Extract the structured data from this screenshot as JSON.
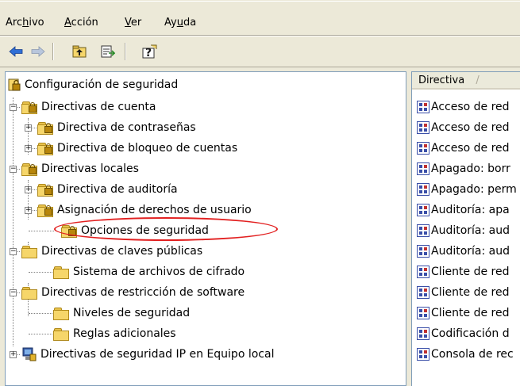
{
  "menubar": {
    "items": [
      {
        "label": "Archivo",
        "pre": "Arc",
        "key": "h",
        "post": "ivo"
      },
      {
        "label": "Acción",
        "pre": "",
        "key": "A",
        "post": "cción"
      },
      {
        "label": "Ver",
        "pre": "",
        "key": "V",
        "post": "er"
      },
      {
        "label": "Ayuda",
        "pre": "Ay",
        "key": "u",
        "post": "da"
      }
    ]
  },
  "toolbar": {
    "buttons": [
      "back-arrow-icon",
      "forward-arrow-icon",
      "up-folder-icon",
      "export-list-icon",
      "help-icon"
    ]
  },
  "tree": {
    "root": "Configuración de seguridad",
    "items": [
      {
        "label": "Directivas de cuenta",
        "level": 1,
        "expander": "-"
      },
      {
        "label": "Directiva de contraseñas",
        "level": 2,
        "expander": "+"
      },
      {
        "label": "Directiva de bloqueo de cuentas",
        "level": 2,
        "expander": "+"
      },
      {
        "label": "Directivas locales",
        "level": 1,
        "expander": "-"
      },
      {
        "label": "Directiva de auditoría",
        "level": 2,
        "expander": "+"
      },
      {
        "label": "Asignación de derechos de usuario",
        "level": 2,
        "expander": "+"
      },
      {
        "label": "Opciones de seguridad",
        "level": 2,
        "expander": "",
        "selected": true
      },
      {
        "label": "Directivas de claves públicas",
        "level": 1,
        "expander": "-"
      },
      {
        "label": "Sistema de archivos de cifrado",
        "level": 2,
        "expander": ""
      },
      {
        "label": "Directivas de restricción de software",
        "level": 1,
        "expander": "-"
      },
      {
        "label": "Niveles de seguridad",
        "level": 2,
        "expander": ""
      },
      {
        "label": "Reglas adicionales",
        "level": 2,
        "expander": ""
      },
      {
        "label": "Directivas de seguridad IP en Equipo local",
        "level": 1,
        "expander": "+"
      }
    ]
  },
  "list": {
    "column_header": "Directiva",
    "sort_indicator": "/",
    "rows": [
      "Acceso de red",
      "Acceso de red",
      "Acceso de red",
      "Apagado: borr",
      "Apagado: perm",
      "Auditoría: apa",
      "Auditoría: aud",
      "Auditoría: aud",
      "Cliente de red",
      "Cliente de red",
      "Cliente de red",
      "Codificación d",
      "Consola de rec"
    ]
  },
  "colors": {
    "chrome": "#ece9d8",
    "highlight_ellipse": "#e22020",
    "folder": "#f6d66a"
  }
}
